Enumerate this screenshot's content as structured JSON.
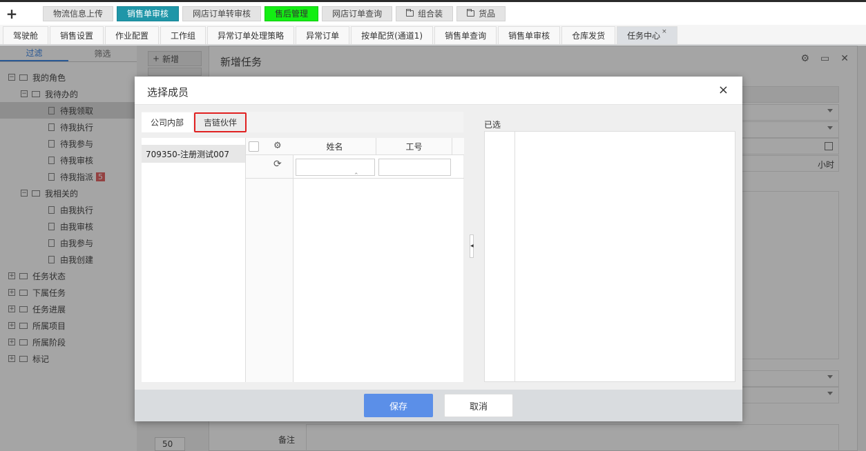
{
  "topbar": {
    "add_icon": "plus-icon",
    "tabs": [
      "物流信息上传",
      "销售单审核",
      "网店订单转审核",
      "售后管理",
      "网店订单查询",
      "组合装",
      "货品"
    ]
  },
  "subtabs": [
    "驾驶舱",
    "销售设置",
    "作业配置",
    "工作组",
    "异常订单处理策略",
    "异常订单",
    "按单配货(通道1)",
    "销售单查询",
    "销售单审核",
    "仓库发货",
    "任务中心"
  ],
  "subtabs_close": "×",
  "left": {
    "tabs": [
      "过滤",
      "筛选"
    ],
    "tree": {
      "my_roles": "我的角色",
      "pending": "我待办的",
      "pending_items": [
        "待我领取",
        "待我执行",
        "待我参与",
        "待我审核",
        "待我指派"
      ],
      "assign_badge": "5",
      "related": "我相关的",
      "related_items": [
        "由我执行",
        "由我审核",
        "由我参与",
        "由我创建"
      ],
      "groups": [
        "任务状态",
        "下属任务",
        "任务进展",
        "所属项目",
        "所属阶段",
        "标记"
      ]
    }
  },
  "toolbar": {
    "new_label": "新增"
  },
  "page_size": "50",
  "form": {
    "title": "新增任务",
    "hour_unit": "小时",
    "remark_label": "备注"
  },
  "dialog": {
    "title": "选择成员",
    "close": "×",
    "tabs": {
      "internal": "公司内部",
      "partner": "吉链伙伴"
    },
    "org_items": [
      "709350-注册测试007"
    ],
    "grid": {
      "col_name": "姓名",
      "col_id": "工号"
    },
    "selected_label": "已选",
    "buttons": {
      "save": "保存",
      "cancel": "取消"
    }
  }
}
